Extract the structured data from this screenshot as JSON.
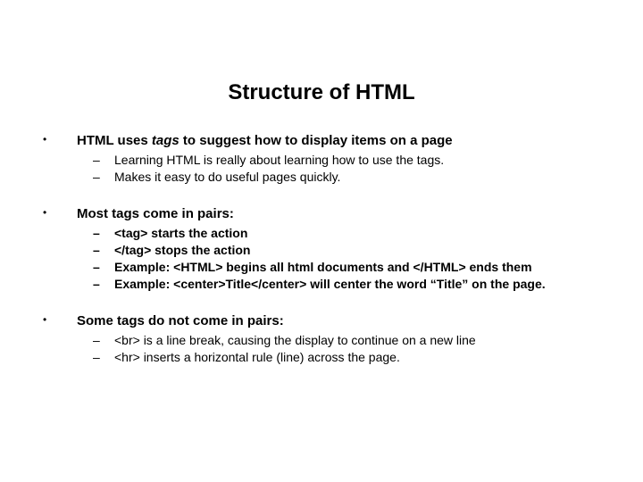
{
  "title": "Structure of  HTML",
  "bullets": [
    {
      "head_pre": "HTML uses ",
      "head_em": "tags",
      "head_post": " to suggest how to display items on a page",
      "subs": [
        "Learning HTML is really about learning how to use the tags.",
        "Makes it easy to do useful pages quickly."
      ]
    },
    {
      "head": "Most tags come in pairs:",
      "subs_bold": [
        "<tag> starts the action",
        "</tag> stops the action",
        "Example:  <HTML> begins all html documents and </HTML> ends them",
        "Example: <center>Title</center> will center the word “Title” on the page."
      ]
    },
    {
      "head": "Some tags do not come in pairs:",
      "subs": [
        "<br> is a line break, causing the display to continue on a new line",
        "<hr> inserts a horizontal rule (line) across the page."
      ]
    }
  ]
}
